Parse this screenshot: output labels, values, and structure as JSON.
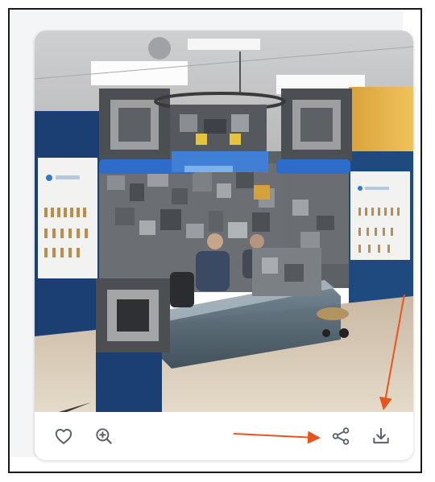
{
  "toolbar": {
    "icons": {
      "like": "heart-icon",
      "zoom": "zoom-in-icon",
      "share": "share-icon",
      "download": "download-icon"
    }
  },
  "colors": {
    "icon": "#5a5f6a",
    "annotation_arrow": "#e8541e",
    "frame_border": "#1a1a1a",
    "panel_bg": "#f4f5f7",
    "card_bg": "#ffffff"
  }
}
